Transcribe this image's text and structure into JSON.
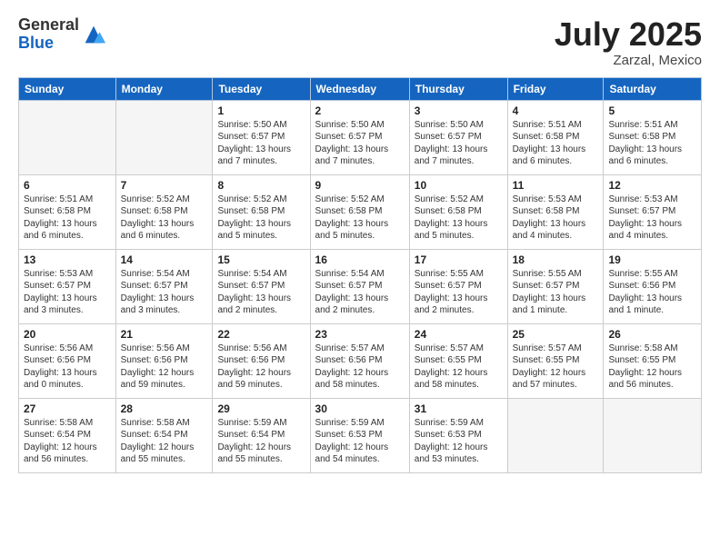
{
  "header": {
    "logo_general": "General",
    "logo_blue": "Blue",
    "month": "July 2025",
    "location": "Zarzal, Mexico"
  },
  "weekdays": [
    "Sunday",
    "Monday",
    "Tuesday",
    "Wednesday",
    "Thursday",
    "Friday",
    "Saturday"
  ],
  "weeks": [
    [
      {
        "day": "",
        "detail": ""
      },
      {
        "day": "",
        "detail": ""
      },
      {
        "day": "1",
        "sunrise": "5:50 AM",
        "sunset": "6:57 PM",
        "daylight": "13 hours and 7 minutes."
      },
      {
        "day": "2",
        "sunrise": "5:50 AM",
        "sunset": "6:57 PM",
        "daylight": "13 hours and 7 minutes."
      },
      {
        "day": "3",
        "sunrise": "5:50 AM",
        "sunset": "6:57 PM",
        "daylight": "13 hours and 7 minutes."
      },
      {
        "day": "4",
        "sunrise": "5:51 AM",
        "sunset": "6:58 PM",
        "daylight": "13 hours and 6 minutes."
      },
      {
        "day": "5",
        "sunrise": "5:51 AM",
        "sunset": "6:58 PM",
        "daylight": "13 hours and 6 minutes."
      }
    ],
    [
      {
        "day": "6",
        "sunrise": "5:51 AM",
        "sunset": "6:58 PM",
        "daylight": "13 hours and 6 minutes."
      },
      {
        "day": "7",
        "sunrise": "5:52 AM",
        "sunset": "6:58 PM",
        "daylight": "13 hours and 6 minutes."
      },
      {
        "day": "8",
        "sunrise": "5:52 AM",
        "sunset": "6:58 PM",
        "daylight": "13 hours and 5 minutes."
      },
      {
        "day": "9",
        "sunrise": "5:52 AM",
        "sunset": "6:58 PM",
        "daylight": "13 hours and 5 minutes."
      },
      {
        "day": "10",
        "sunrise": "5:52 AM",
        "sunset": "6:58 PM",
        "daylight": "13 hours and 5 minutes."
      },
      {
        "day": "11",
        "sunrise": "5:53 AM",
        "sunset": "6:58 PM",
        "daylight": "13 hours and 4 minutes."
      },
      {
        "day": "12",
        "sunrise": "5:53 AM",
        "sunset": "6:57 PM",
        "daylight": "13 hours and 4 minutes."
      }
    ],
    [
      {
        "day": "13",
        "sunrise": "5:53 AM",
        "sunset": "6:57 PM",
        "daylight": "13 hours and 3 minutes."
      },
      {
        "day": "14",
        "sunrise": "5:54 AM",
        "sunset": "6:57 PM",
        "daylight": "13 hours and 3 minutes."
      },
      {
        "day": "15",
        "sunrise": "5:54 AM",
        "sunset": "6:57 PM",
        "daylight": "13 hours and 2 minutes."
      },
      {
        "day": "16",
        "sunrise": "5:54 AM",
        "sunset": "6:57 PM",
        "daylight": "13 hours and 2 minutes."
      },
      {
        "day": "17",
        "sunrise": "5:55 AM",
        "sunset": "6:57 PM",
        "daylight": "13 hours and 2 minutes."
      },
      {
        "day": "18",
        "sunrise": "5:55 AM",
        "sunset": "6:57 PM",
        "daylight": "13 hours and 1 minute."
      },
      {
        "day": "19",
        "sunrise": "5:55 AM",
        "sunset": "6:56 PM",
        "daylight": "13 hours and 1 minute."
      }
    ],
    [
      {
        "day": "20",
        "sunrise": "5:56 AM",
        "sunset": "6:56 PM",
        "daylight": "13 hours and 0 minutes."
      },
      {
        "day": "21",
        "sunrise": "5:56 AM",
        "sunset": "6:56 PM",
        "daylight": "12 hours and 59 minutes."
      },
      {
        "day": "22",
        "sunrise": "5:56 AM",
        "sunset": "6:56 PM",
        "daylight": "12 hours and 59 minutes."
      },
      {
        "day": "23",
        "sunrise": "5:57 AM",
        "sunset": "6:56 PM",
        "daylight": "12 hours and 58 minutes."
      },
      {
        "day": "24",
        "sunrise": "5:57 AM",
        "sunset": "6:55 PM",
        "daylight": "12 hours and 58 minutes."
      },
      {
        "day": "25",
        "sunrise": "5:57 AM",
        "sunset": "6:55 PM",
        "daylight": "12 hours and 57 minutes."
      },
      {
        "day": "26",
        "sunrise": "5:58 AM",
        "sunset": "6:55 PM",
        "daylight": "12 hours and 56 minutes."
      }
    ],
    [
      {
        "day": "27",
        "sunrise": "5:58 AM",
        "sunset": "6:54 PM",
        "daylight": "12 hours and 56 minutes."
      },
      {
        "day": "28",
        "sunrise": "5:58 AM",
        "sunset": "6:54 PM",
        "daylight": "12 hours and 55 minutes."
      },
      {
        "day": "29",
        "sunrise": "5:59 AM",
        "sunset": "6:54 PM",
        "daylight": "12 hours and 55 minutes."
      },
      {
        "day": "30",
        "sunrise": "5:59 AM",
        "sunset": "6:53 PM",
        "daylight": "12 hours and 54 minutes."
      },
      {
        "day": "31",
        "sunrise": "5:59 AM",
        "sunset": "6:53 PM",
        "daylight": "12 hours and 53 minutes."
      },
      {
        "day": "",
        "detail": ""
      },
      {
        "day": "",
        "detail": ""
      }
    ]
  ]
}
